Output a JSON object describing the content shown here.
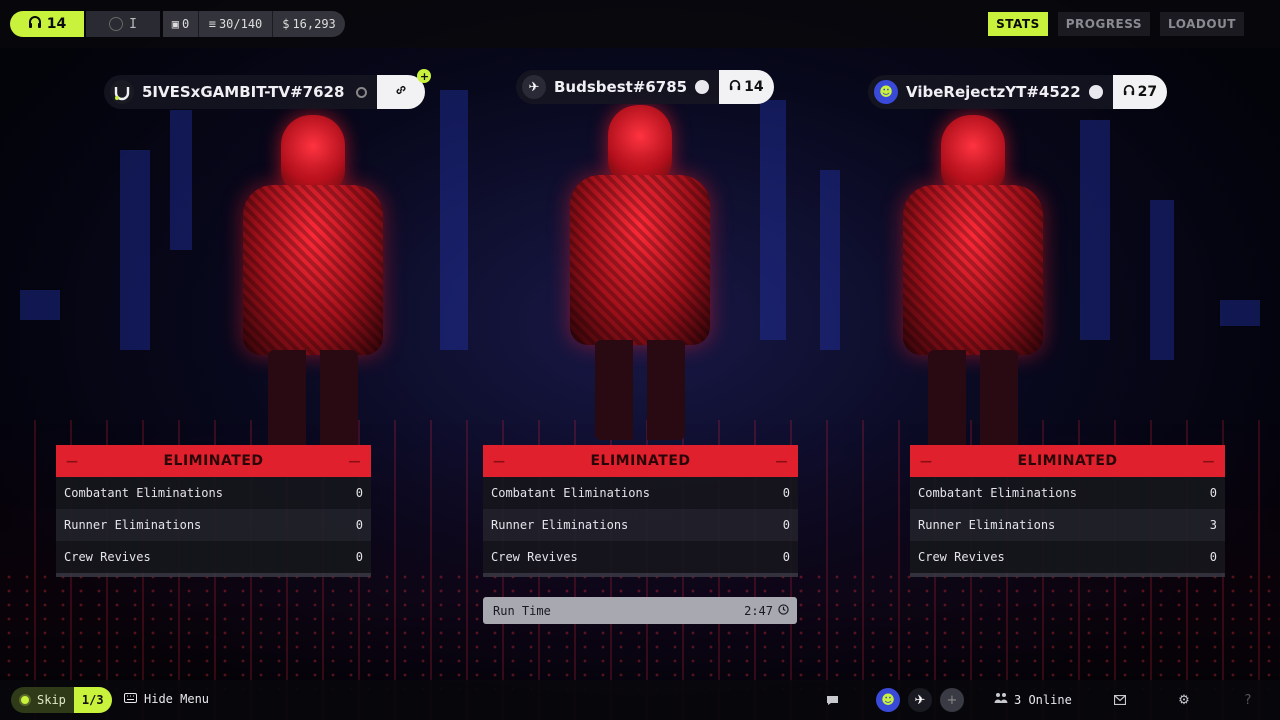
{
  "topbar": {
    "level": "14",
    "slot_label": "I",
    "crates": "0",
    "capacity": "30/140",
    "credits": "16,293",
    "tabs": [
      {
        "label": "STATS",
        "active": true
      },
      {
        "label": "PROGRESS",
        "active": false
      },
      {
        "label": "LOADOUT",
        "active": false
      }
    ]
  },
  "players": [
    {
      "name": "5IVESxGAMBIT-TV#7628",
      "status": "ELIMINATED",
      "stats": [
        {
          "label": "Combatant Eliminations",
          "value": "0"
        },
        {
          "label": "Runner Eliminations",
          "value": "0"
        },
        {
          "label": "Crew Revives",
          "value": "0"
        }
      ]
    },
    {
      "name": "Budsbest#6785",
      "level": "14",
      "status": "ELIMINATED",
      "stats": [
        {
          "label": "Combatant Eliminations",
          "value": "0"
        },
        {
          "label": "Runner Eliminations",
          "value": "0"
        },
        {
          "label": "Crew Revives",
          "value": "0"
        }
      ]
    },
    {
      "name": "VibeRejectzYT#4522",
      "level": "27",
      "status": "ELIMINATED",
      "stats": [
        {
          "label": "Combatant Eliminations",
          "value": "0"
        },
        {
          "label": "Runner Eliminations",
          "value": "3"
        },
        {
          "label": "Crew Revives",
          "value": "0"
        }
      ]
    }
  ],
  "run_time": {
    "label": "Run Time",
    "value": "2:47"
  },
  "bottombar": {
    "skip_label": "Skip",
    "skip_progress": "1/3",
    "hide_menu": "Hide Menu",
    "online": "3 Online"
  },
  "colors": {
    "accent": "#c8f23c",
    "eliminated": "#e0202c",
    "panel": "#16161c"
  }
}
